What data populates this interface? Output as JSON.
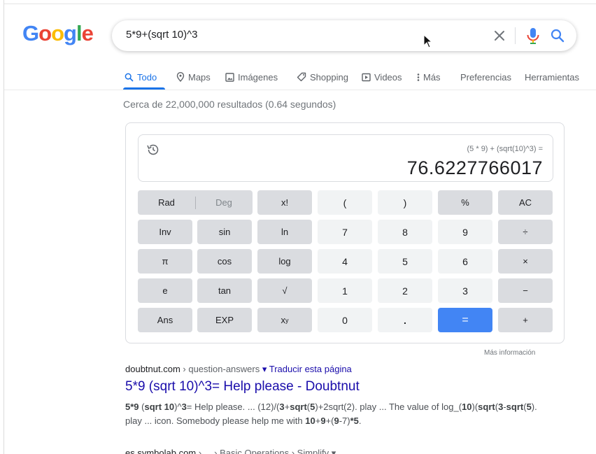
{
  "colors": {
    "accent": "#1a73e8",
    "link": "#1a0dab",
    "equals_key": "#4285f4",
    "key_function": "#dadce0",
    "key_number": "#f1f3f4"
  },
  "logo": {
    "g1": "G",
    "o1": "o",
    "o2": "o",
    "g2": "g",
    "l": "l",
    "e": "e"
  },
  "search": {
    "query": "5*9+(sqrt 10)^3",
    "clear_icon": "close-icon",
    "voice_icon": "mic-icon",
    "submit_icon": "search-icon"
  },
  "tabs": [
    {
      "label": "Todo",
      "icon": "search-icon",
      "active": true
    },
    {
      "label": "Maps",
      "icon": "map-pin-icon"
    },
    {
      "label": "Imágenes",
      "icon": "image-icon"
    },
    {
      "label": "Shopping",
      "icon": "tag-icon"
    },
    {
      "label": "Videos",
      "icon": "play-icon"
    },
    {
      "label": "Más",
      "icon": "more-vert-icon"
    },
    {
      "label": "Preferencias"
    },
    {
      "label": "Herramientas"
    }
  ],
  "result_stats": "Cerca de 22,000,000 resultados (0.64 segundos)",
  "calculator": {
    "expression": "(5 * 9) + (sqrt(10)^3) =",
    "result": "76.6227766017",
    "keys": {
      "rad": "Rad",
      "deg": "Deg",
      "fact": "x!",
      "lparen": "(",
      "rparen": ")",
      "pct": "%",
      "ac": "AC",
      "inv": "Inv",
      "sin": "sin",
      "ln": "ln",
      "n7": "7",
      "n8": "8",
      "n9": "9",
      "div": "÷",
      "pi": "π",
      "cos": "cos",
      "log": "log",
      "n4": "4",
      "n5": "5",
      "n6": "6",
      "mul": "×",
      "e": "e",
      "tan": "tan",
      "sqrt": "√",
      "n1": "1",
      "n2": "2",
      "n3": "3",
      "sub": "−",
      "ans": "Ans",
      "exp": "EXP",
      "pow_base": "x",
      "pow_exp": "y",
      "n0": "0",
      "dot": ".",
      "eq": "=",
      "add": "+"
    },
    "more_info": "Más información"
  },
  "results": [
    {
      "site": "doubtnut.com",
      "sep": " › ",
      "path": "question-answers",
      "translate": "▾ Traducir esta página",
      "title": "5*9 (sqrt 10)^3= Help please - Doubtnut",
      "snippet_parts": [
        "5*9",
        " (",
        "sqrt 10",
        ")^",
        "3",
        "= Help please. ... (12)/(",
        "3",
        "+",
        "sqrt",
        "(",
        "5",
        ")+2sqrt(2). play ... The value of log_(",
        "10",
        ")(",
        "sqrt",
        "(",
        "3",
        "-",
        "sqrt",
        "(",
        "5",
        "). play ... icon. Somebody please help me with ",
        "10",
        "+",
        "9",
        "+(",
        "9",
        "-7)",
        "*5",
        "."
      ]
    },
    {
      "site": "es.symbolab.com",
      "path": "› ... › Basic Operations › Simplify",
      "caret": "▾"
    }
  ]
}
